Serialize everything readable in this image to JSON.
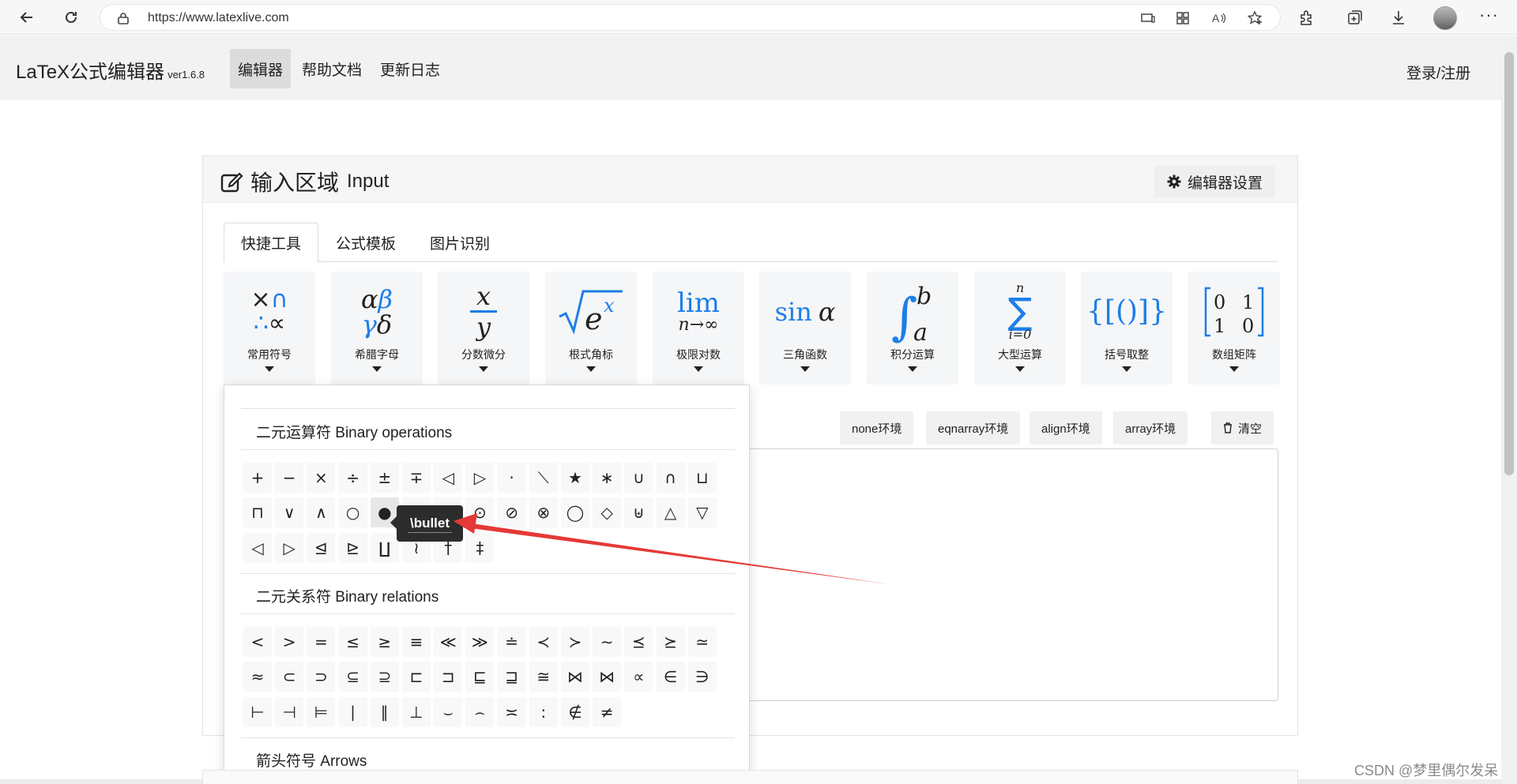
{
  "browser": {
    "url": "https://www.latexlive.com"
  },
  "navbar": {
    "brand": "LaTeX公式编辑器",
    "version": "ver1.6.8",
    "items": [
      "编辑器",
      "帮助文档",
      "更新日志"
    ],
    "active_index": 0,
    "login": "登录/注册"
  },
  "card": {
    "title": "输入区域",
    "title_en": "Input",
    "settings_label": "编辑器设置"
  },
  "tabs": [
    "快捷工具",
    "公式模板",
    "图片识别"
  ],
  "tools": [
    {
      "label": "常用符号",
      "icon": "common-symbols-icon",
      "glyph_lines": [
        "×∩",
        "∴∝"
      ]
    },
    {
      "label": "希腊字母",
      "icon": "greek-letters-icon",
      "glyph_lines": [
        "αβ",
        "γδ"
      ]
    },
    {
      "label": "分数微分",
      "icon": "fraction-icon",
      "glyph_lines": [
        "x",
        "y"
      ]
    },
    {
      "label": "根式角标",
      "icon": "radical-icon",
      "glyph_lines": [
        "√",
        "e",
        "x"
      ]
    },
    {
      "label": "极限对数",
      "icon": "limit-icon",
      "glyph_lines": [
        "lim",
        "n→∞"
      ]
    },
    {
      "label": "三角函数",
      "icon": "trig-icon",
      "glyph_lines": [
        "sin",
        "α"
      ]
    },
    {
      "label": "积分运算",
      "icon": "integral-icon",
      "glyph_lines": [
        "∫",
        "b",
        "a"
      ]
    },
    {
      "label": "大型运算",
      "icon": "sum-icon",
      "glyph_lines": [
        "n",
        "∑",
        "i=0"
      ]
    },
    {
      "label": "括号取整",
      "icon": "bracket-icon",
      "glyph_lines": [
        "{[()]}"
      ]
    },
    {
      "label": "数组矩阵",
      "icon": "matrix-icon",
      "glyph_lines": [
        "0",
        "1",
        "1",
        "0"
      ]
    }
  ],
  "environments": [
    "none环境",
    "eqnarray环境",
    "align环境",
    "array环境"
  ],
  "clear_label": "清空",
  "panel": {
    "sections": [
      {
        "title": "二元运算符 Binary operations",
        "rows": [
          [
            "+",
            "−",
            "×",
            "÷",
            "±",
            "∓",
            "◁",
            "▷",
            "·",
            "⟍",
            "★",
            "∗",
            "∪",
            "∩",
            "⊔"
          ],
          [
            "⊓",
            "∨",
            "∧",
            "○",
            "●",
            "⊕",
            "⊖",
            "⊙",
            "⊘",
            "⊗",
            "◯",
            "◇",
            "⊎",
            "△",
            "▽"
          ],
          [
            "◁",
            "▷",
            "⊴",
            "⊵",
            "∐",
            "≀",
            "†",
            "‡"
          ]
        ]
      },
      {
        "title": "二元关系符 Binary relations",
        "rows": [
          [
            "<",
            ">",
            "=",
            "≤",
            "≥",
            "≡",
            "≪",
            "≫",
            "≐",
            "≺",
            "≻",
            "∼",
            "⪯",
            "⪰",
            "≃"
          ],
          [
            "≈",
            "⊂",
            "⊃",
            "⊆",
            "⊇",
            "⊏",
            "⊐",
            "⊑",
            "⊒",
            "≅",
            "⋈",
            "⋈",
            "∝",
            "∈",
            "∋"
          ],
          [
            "⊢",
            "⊣",
            "⊨",
            "∣",
            "∥",
            "⊥",
            "⌣",
            "⌢",
            "≍",
            ":",
            "∉",
            "≠"
          ]
        ]
      },
      {
        "title": "箭头符号 Arrows",
        "rows": []
      }
    ]
  },
  "tooltip": "\\bullet",
  "watermark": "CSDN @梦里偶尔发呆",
  "colors": {
    "accent_blue": "#1e7ee8",
    "arrow_red": "#e53935"
  }
}
